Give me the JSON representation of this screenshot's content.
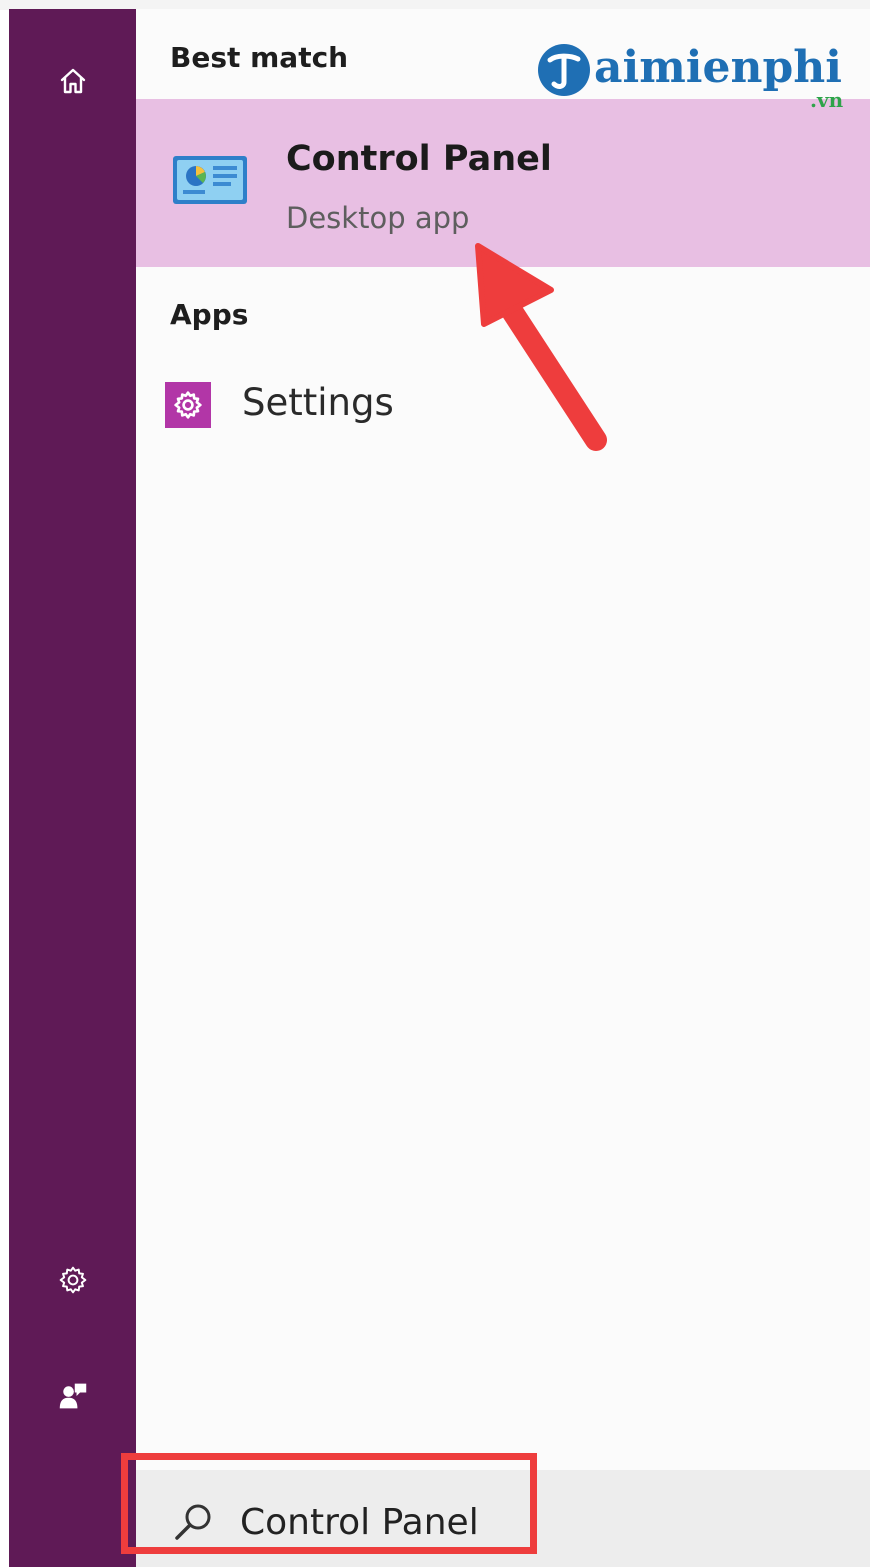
{
  "results": {
    "best_match_heading": "Best match",
    "best_match": {
      "title": "Control Panel",
      "subtitle": "Desktop app",
      "icon": "control-panel-icon"
    },
    "apps_heading": "Apps",
    "apps": [
      {
        "label": "Settings",
        "icon": "settings-gear-icon"
      }
    ]
  },
  "search": {
    "value": "Control Panel"
  },
  "sidebar": {
    "icons": [
      "home-icon",
      "settings-icon",
      "feedback-icon"
    ]
  },
  "watermark": {
    "brand": "aimienphi",
    "domain": ".vn"
  },
  "colors": {
    "sidebar": "#5f1a56",
    "highlight": "#e8bfe3",
    "annotation": "#ee3d3d",
    "settings_tile": "#b236a7"
  }
}
